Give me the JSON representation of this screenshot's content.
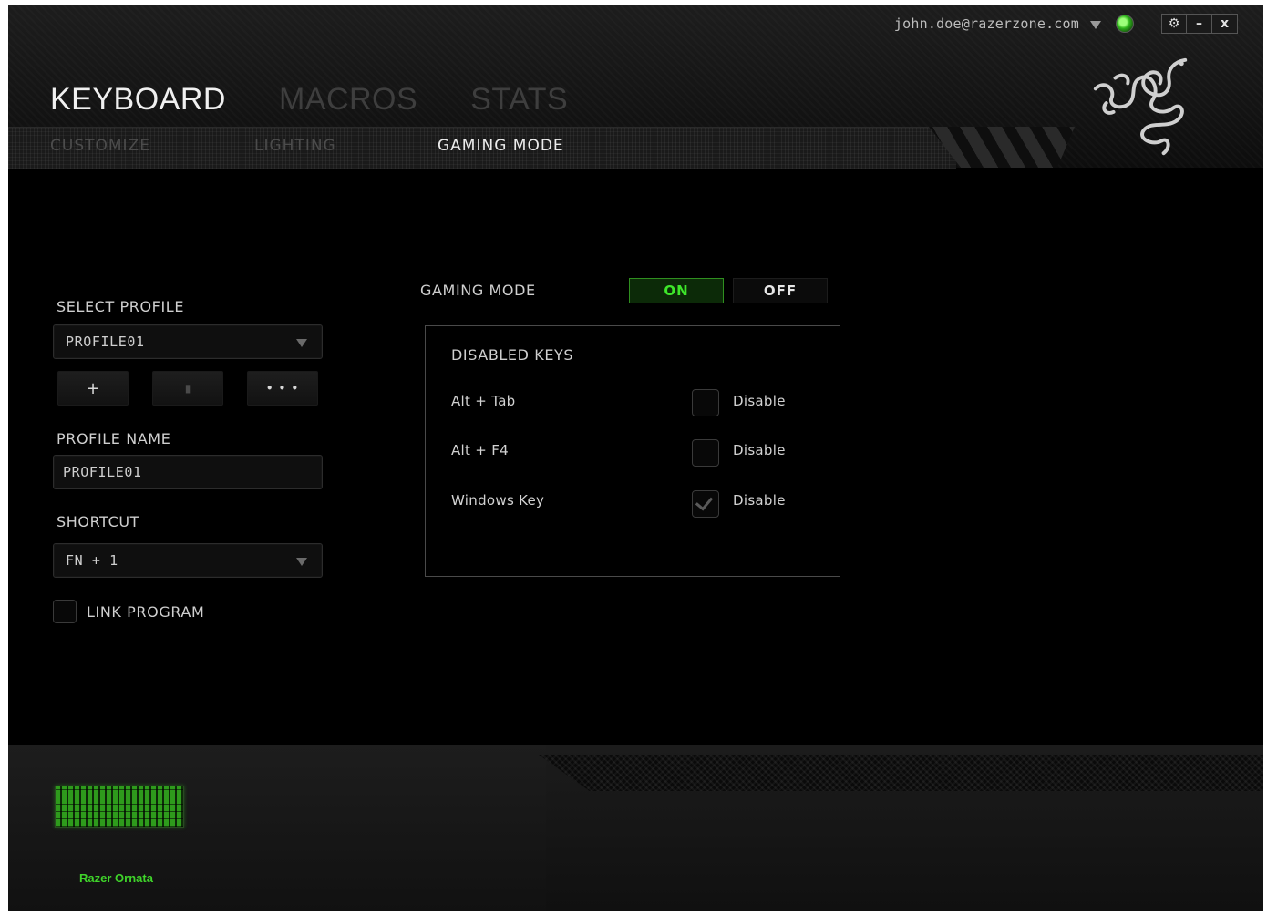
{
  "window": {
    "account_email": "john.doe@razerzone.com",
    "controls": {
      "settings": "⚙",
      "minimize": "–",
      "close": "x"
    }
  },
  "main_tabs": [
    {
      "label": "KEYBOARD",
      "active": true
    },
    {
      "label": "MACROS",
      "active": false
    },
    {
      "label": "STATS",
      "active": false
    }
  ],
  "sub_tabs": [
    {
      "label": "CUSTOMIZE",
      "active": false
    },
    {
      "label": "LIGHTING",
      "active": false
    },
    {
      "label": "GAMING MODE",
      "active": true
    }
  ],
  "profile": {
    "select_label": "SELECT PROFILE",
    "selected_profile": "PROFILE01",
    "buttons": {
      "add": "+",
      "delete": "▮",
      "more": "• • •"
    },
    "name_label": "PROFILE NAME",
    "name_value": "PROFILE01",
    "shortcut_label": "SHORTCUT",
    "shortcut_value": "FN + 1",
    "link_program_label": "LINK PROGRAM",
    "link_program_checked": false
  },
  "gaming_mode": {
    "label": "GAMING MODE",
    "on_label": "ON",
    "off_label": "OFF",
    "state": "on",
    "disabled_keys_title": "DISABLED KEYS",
    "keys": [
      {
        "name": "Alt + Tab",
        "action": "Disable",
        "checked": false
      },
      {
        "name": "Alt + F4",
        "action": "Disable",
        "checked": false
      },
      {
        "name": "Windows Key",
        "action": "Disable",
        "checked": true
      }
    ]
  },
  "device": {
    "name": "Razer Ornata"
  },
  "colors": {
    "accent_green": "#3ee62a",
    "background": "#000000"
  },
  "icons": {
    "logo": "razer-snake-logo",
    "status": "online-status-icon",
    "settings": "gear-icon"
  }
}
